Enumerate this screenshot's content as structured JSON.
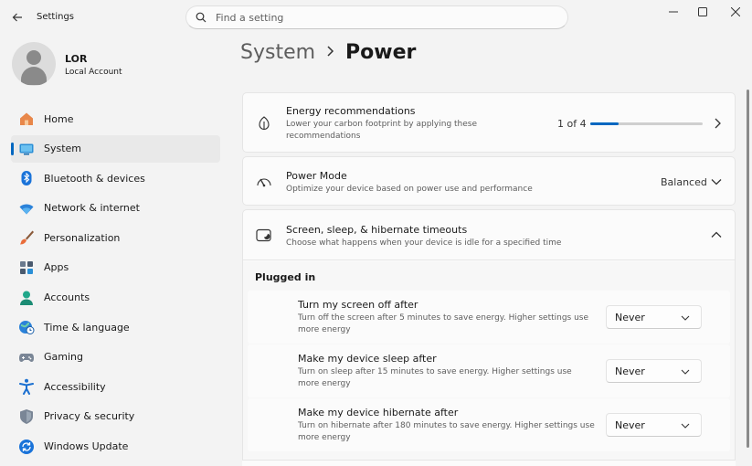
{
  "app": {
    "title": "Settings"
  },
  "search": {
    "placeholder": "Find a setting"
  },
  "user": {
    "name": "LOR",
    "account_type": "Local Account"
  },
  "nav": {
    "items": [
      {
        "label": "Home",
        "icon": "home-icon"
      },
      {
        "label": "System",
        "icon": "system-icon",
        "active": true
      },
      {
        "label": "Bluetooth & devices",
        "icon": "bluetooth-icon"
      },
      {
        "label": "Network & internet",
        "icon": "wifi-icon"
      },
      {
        "label": "Personalization",
        "icon": "brush-icon"
      },
      {
        "label": "Apps",
        "icon": "apps-icon"
      },
      {
        "label": "Accounts",
        "icon": "accounts-icon"
      },
      {
        "label": "Time & language",
        "icon": "globe-clock-icon"
      },
      {
        "label": "Gaming",
        "icon": "gamepad-icon"
      },
      {
        "label": "Accessibility",
        "icon": "accessibility-icon"
      },
      {
        "label": "Privacy & security",
        "icon": "shield-icon"
      },
      {
        "label": "Windows Update",
        "icon": "update-icon"
      }
    ]
  },
  "breadcrumb": {
    "parent": "System",
    "current": "Power"
  },
  "energy": {
    "title": "Energy recommendations",
    "description": "Lower your carbon footprint by applying these recommendations",
    "progress_text": "1 of 4",
    "progress_fraction": 0.25
  },
  "power_mode": {
    "title": "Power Mode",
    "description": "Optimize your device based on power use and performance",
    "value": "Balanced"
  },
  "timeouts": {
    "title": "Screen, sleep, & hibernate timeouts",
    "description": "Choose what happens when your device is idle for a specified time",
    "section_label": "Plugged in",
    "rows": [
      {
        "title": "Turn my screen off after",
        "description": "Turn off the screen after 5 minutes to save energy. Higher settings use more energy",
        "value": "Never"
      },
      {
        "title": "Make my device sleep after",
        "description": "Turn on sleep after 15 minutes to save energy. Higher settings use more energy",
        "value": "Never"
      },
      {
        "title": "Make my device hibernate after",
        "description": "Turn on hibernate after 180 minutes to save energy. Higher settings use more energy",
        "value": "Never"
      }
    ]
  },
  "colors": {
    "accent": "#0067c0",
    "window_bg": "#f3f3f3",
    "card_bg": "#fbfbfb"
  }
}
